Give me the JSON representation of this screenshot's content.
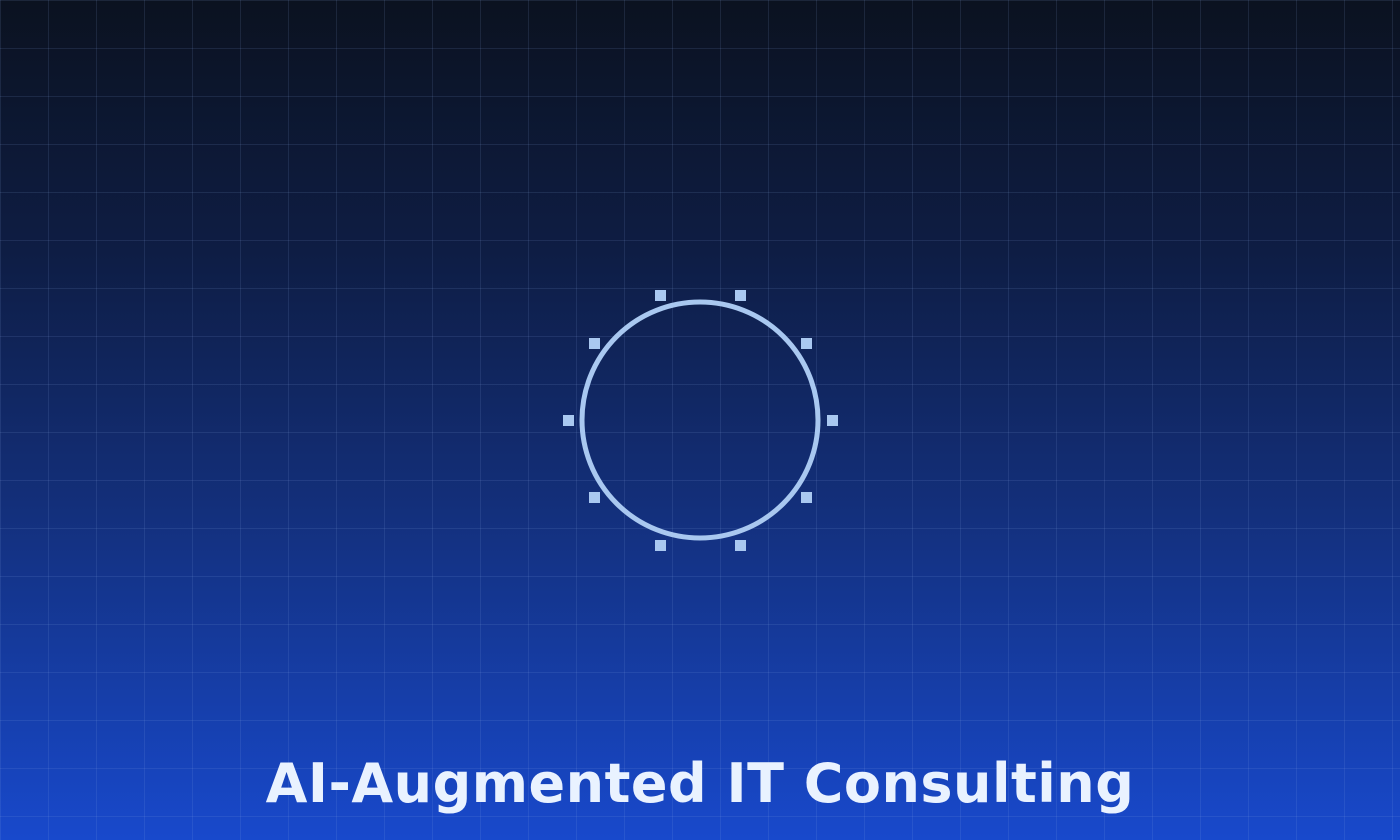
{
  "hero": {
    "title": "AI-Augmented IT Consulting",
    "emblem_icon": "gear-ring-icon"
  },
  "colors": {
    "background_top": "#0b1220",
    "background_bottom": "#1849cc",
    "emblem": "#a9c8f0",
    "title": "#e9f2ff"
  }
}
